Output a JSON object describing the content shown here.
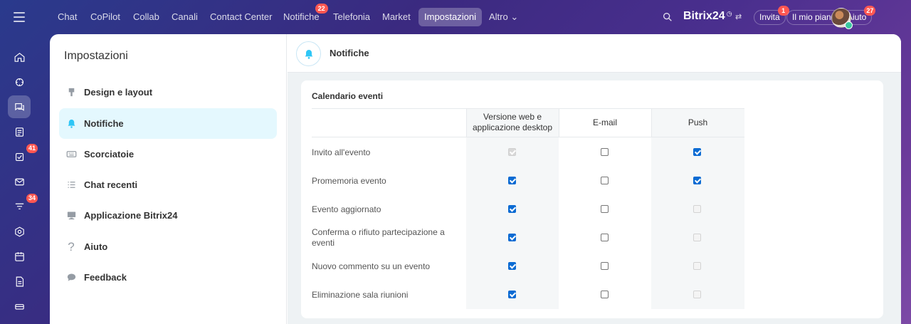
{
  "topnav": {
    "items": [
      {
        "label": "Chat"
      },
      {
        "label": "CoPilot"
      },
      {
        "label": "Collab"
      },
      {
        "label": "Canali"
      },
      {
        "label": "Contact Center"
      },
      {
        "label": "Notifiche",
        "badge": "22"
      },
      {
        "label": "Telefonia"
      },
      {
        "label": "Market"
      },
      {
        "label": "Impostazioni"
      },
      {
        "label": "Altro ⌄"
      }
    ],
    "brand": "Bitrix24",
    "invite": {
      "label": "Invita",
      "badge": "1"
    },
    "plan": {
      "label": "Il mio piano"
    },
    "help": {
      "label": "Aiuto",
      "badge": "27"
    }
  },
  "rail": {
    "badges": {
      "tasks": "41",
      "feed": "34"
    }
  },
  "sidebar": {
    "title": "Impostazioni",
    "items": [
      {
        "label": "Design e layout"
      },
      {
        "label": "Notifiche"
      },
      {
        "label": "Scorciatoie"
      },
      {
        "label": "Chat recenti"
      },
      {
        "label": "Applicazione Bitrix24"
      },
      {
        "label": "Aiuto"
      },
      {
        "label": "Feedback"
      }
    ]
  },
  "content": {
    "title": "Notifiche",
    "section_title": "Calendario eventi",
    "columns": [
      "Versione web e applicazione desktop",
      "E-mail",
      "Push"
    ],
    "rows": [
      {
        "label": "Invito all'evento",
        "web": "disabled-checked",
        "email": "unchecked",
        "push": "checked"
      },
      {
        "label": "Promemoria evento",
        "web": "checked",
        "email": "unchecked",
        "push": "checked"
      },
      {
        "label": "Evento aggiornato",
        "web": "checked",
        "email": "unchecked",
        "push": "disabled"
      },
      {
        "label": "Conferma o rifiuto partecipazione a eventi",
        "web": "checked",
        "email": "unchecked",
        "push": "disabled"
      },
      {
        "label": "Nuovo commento su un evento",
        "web": "checked",
        "email": "unchecked",
        "push": "disabled"
      },
      {
        "label": "Eliminazione sala riunioni",
        "web": "checked",
        "email": "unchecked",
        "push": "disabled"
      }
    ]
  },
  "colors": {
    "accent": "#0b6bd3",
    "active_bg": "#e4f8fe",
    "badge": "#ff5752"
  }
}
